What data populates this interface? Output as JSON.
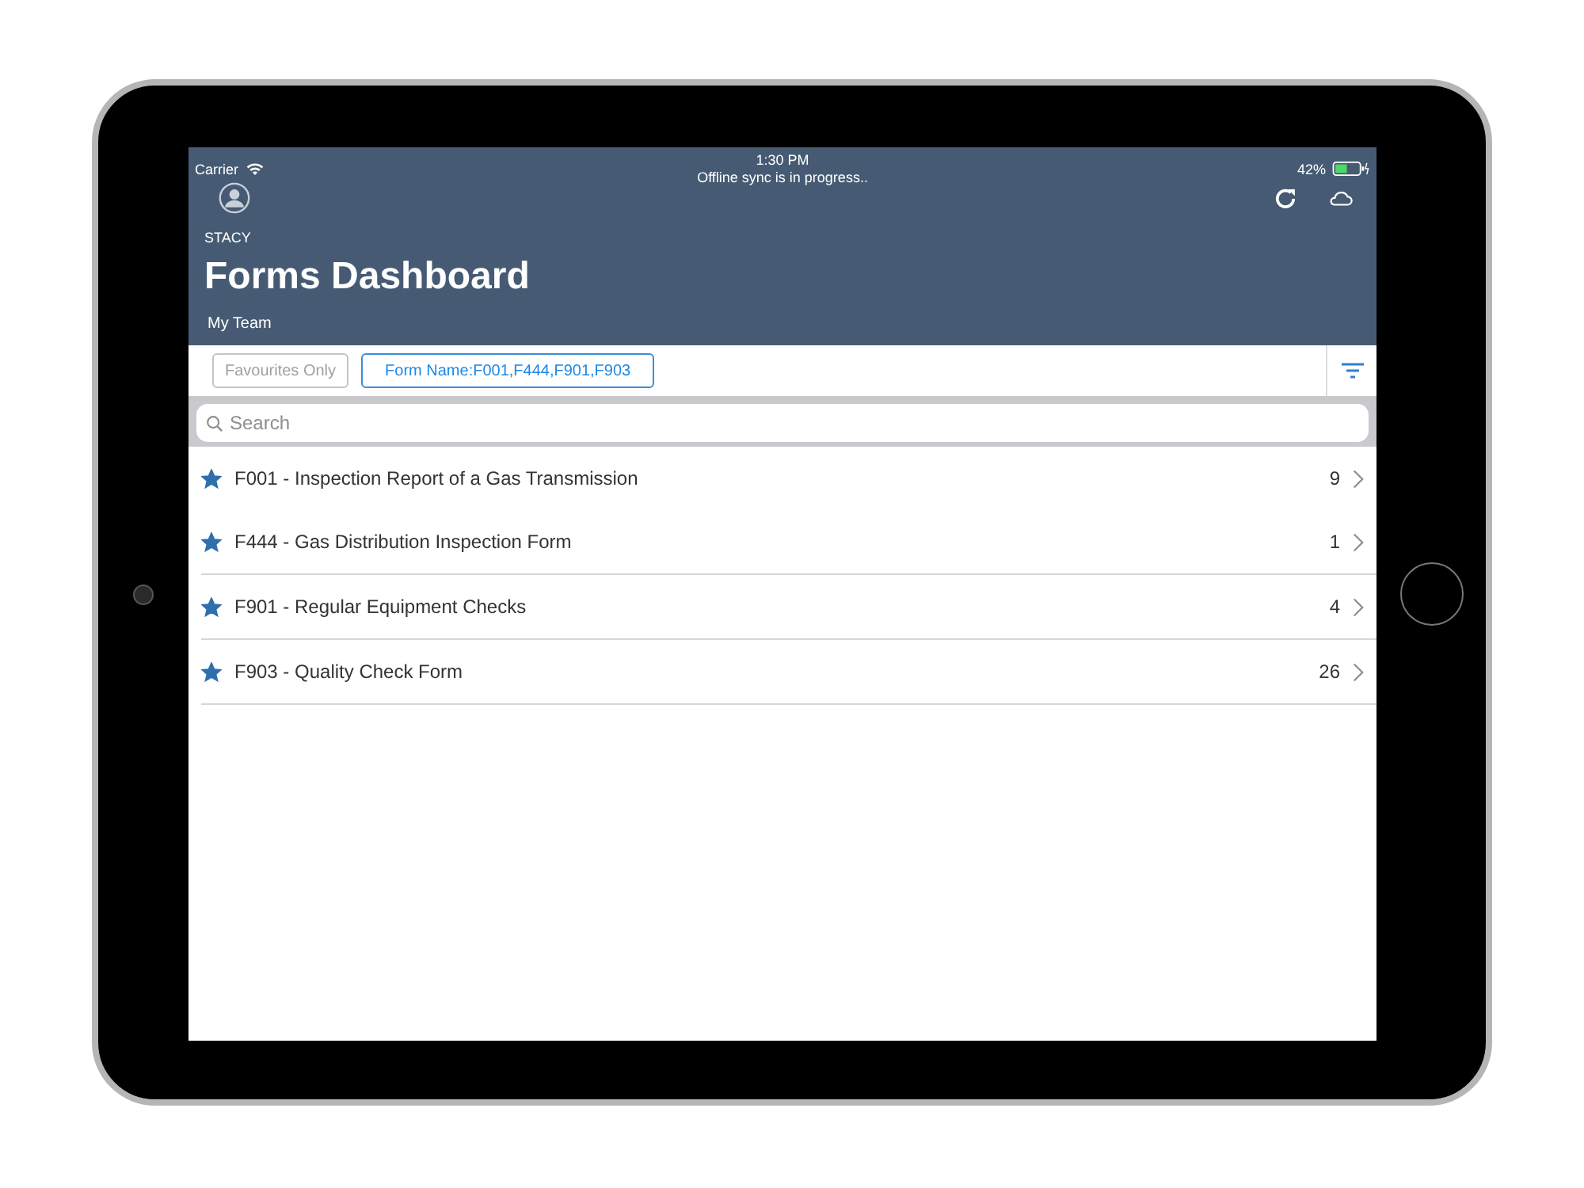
{
  "status_bar": {
    "carrier": "Carrier",
    "time": "1:30 PM",
    "battery": "42%"
  },
  "header": {
    "sync_message": "Offline sync is in progress..",
    "user": "STACY",
    "title": "Forms Dashboard",
    "team": "My Team"
  },
  "filters": [
    {
      "label": "Favourites Only",
      "selected": false
    },
    {
      "label": "Form Name:F001,F444,F901,F903",
      "selected": true
    }
  ],
  "search": {
    "placeholder": "Search"
  },
  "forms": [
    {
      "name": "F001 - Inspection Report of a Gas Transmission",
      "count": "9",
      "favourite": true
    },
    {
      "name": "F444 - Gas Distribution Inspection Form",
      "count": "1",
      "favourite": true
    },
    {
      "name": "F901 - Regular Equipment Checks",
      "count": "4",
      "favourite": true
    },
    {
      "name": "F903 - Quality Check Form",
      "count": "26",
      "favourite": true
    }
  ]
}
